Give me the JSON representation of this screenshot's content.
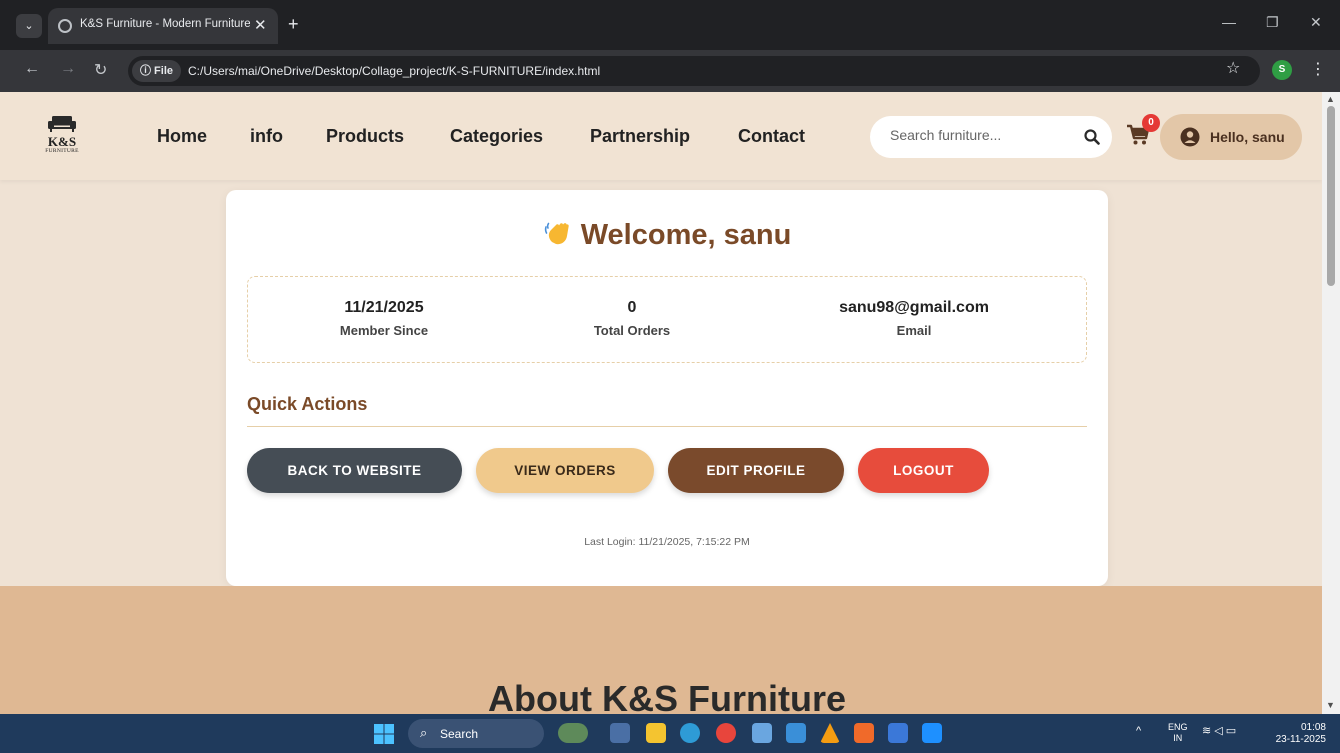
{
  "browser": {
    "tab_title": "K&S Furniture - Modern Furniture",
    "tab_close": "✕",
    "new_tab": "+",
    "file_chip": "ⓘ File",
    "url": "C:/Users/mai/OneDrive/Desktop/Collage_project/K-S-FURNITURE/index.html",
    "profile_initial": "S"
  },
  "header": {
    "logo_text": "K&S",
    "logo_sub": "FURNITURE",
    "nav": [
      "Home",
      "info",
      "Products",
      "Categories",
      "Partnership",
      "Contact"
    ],
    "search_placeholder": "Search furniture...",
    "cart_count": "0",
    "user_greeting": "Hello, sanu"
  },
  "profile": {
    "welcome": "Welcome, sanu",
    "stats": [
      {
        "value": "11/21/2025",
        "label": "Member Since"
      },
      {
        "value": "0",
        "label": "Total Orders"
      },
      {
        "value": "sanu98@gmail.com",
        "label": "Email"
      }
    ],
    "quick_actions_title": "Quick Actions",
    "buttons": {
      "back": "BACK TO WEBSITE",
      "orders": "VIEW ORDERS",
      "edit": "EDIT PROFILE",
      "logout": "LOGOUT"
    },
    "last_login": "Last Login: 11/21/2025, 7:15:22 PM"
  },
  "about": {
    "title": "About K&S Furniture"
  },
  "taskbar": {
    "search_label": "Search",
    "lang_top": "ENG",
    "lang_bottom": "IN",
    "time": "01:08",
    "date": "23-11-2025"
  },
  "colors": {
    "accent_brown": "#7a4a28",
    "page_bg": "#efe2d4",
    "about_bg": "#dfb893",
    "logout_red": "#e74c3c",
    "orders_tan": "#f0c98c"
  }
}
